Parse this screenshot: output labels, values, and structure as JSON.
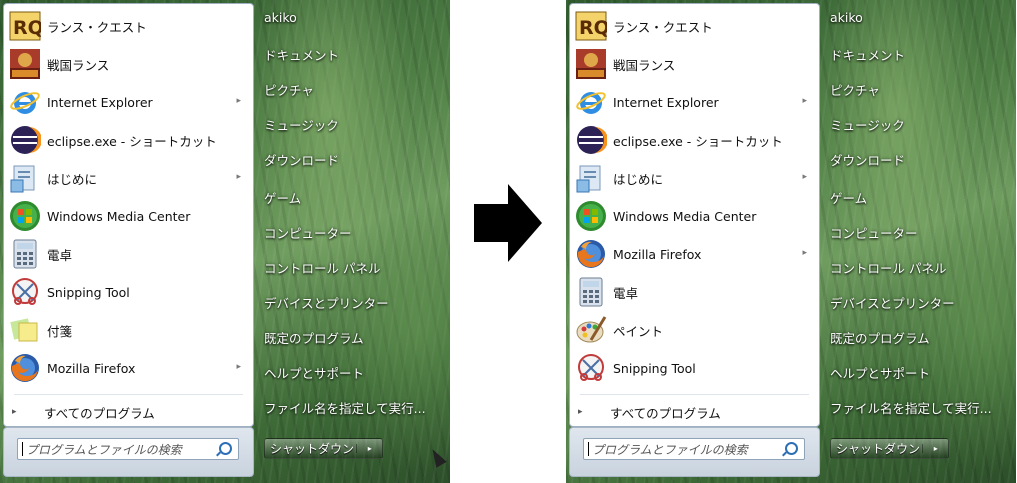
{
  "before": {
    "programs": [
      {
        "label": "ランス・クエスト",
        "icon": "rance-quest-icon",
        "arrow": false
      },
      {
        "label": "戦国ランス",
        "icon": "sengoku-rance-icon",
        "arrow": false
      },
      {
        "label": "Internet Explorer",
        "icon": "internet-explorer-icon",
        "arrow": true
      },
      {
        "label": "eclipse.exe - ショートカット",
        "icon": "eclipse-icon",
        "arrow": false
      },
      {
        "label": "はじめに",
        "icon": "getting-started-icon",
        "arrow": true
      },
      {
        "label": "Windows Media Center",
        "icon": "windows-media-center-icon",
        "arrow": false
      },
      {
        "label": "電卓",
        "icon": "calculator-icon",
        "arrow": false
      },
      {
        "label": "Snipping Tool",
        "icon": "snipping-tool-icon",
        "arrow": false
      },
      {
        "label": "付箋",
        "icon": "sticky-notes-icon",
        "arrow": false
      },
      {
        "label": "Mozilla Firefox",
        "icon": "firefox-icon",
        "arrow": true
      }
    ],
    "all_programs": "すべてのプログラム",
    "search_placeholder": "プログラムとファイルの検索",
    "places": [
      "akiko",
      "ドキュメント",
      "ピクチャ",
      "ミュージック",
      "ダウンロード",
      "ゲーム",
      "コンピューター",
      "コントロール パネル",
      "デバイスとプリンター",
      "既定のプログラム",
      "ヘルプとサポート",
      "ファイル名を指定して実行..."
    ],
    "shutdown": "シャットダウン"
  },
  "after": {
    "programs": [
      {
        "label": "ランス・クエスト",
        "icon": "rance-quest-icon",
        "arrow": false
      },
      {
        "label": "戦国ランス",
        "icon": "sengoku-rance-icon",
        "arrow": false
      },
      {
        "label": "Internet Explorer",
        "icon": "internet-explorer-icon",
        "arrow": true
      },
      {
        "label": "eclipse.exe - ショートカット",
        "icon": "eclipse-icon",
        "arrow": false
      },
      {
        "label": "はじめに",
        "icon": "getting-started-icon",
        "arrow": true
      },
      {
        "label": "Windows Media Center",
        "icon": "windows-media-center-icon",
        "arrow": false
      },
      {
        "label": "Mozilla Firefox",
        "icon": "firefox-icon",
        "arrow": true
      },
      {
        "label": "電卓",
        "icon": "calculator-icon",
        "arrow": false
      },
      {
        "label": "ペイント",
        "icon": "paint-icon",
        "arrow": false
      },
      {
        "label": "Snipping Tool",
        "icon": "snipping-tool-icon",
        "arrow": false
      }
    ],
    "all_programs": "すべてのプログラム",
    "search_placeholder": "プログラムとファイルの検索",
    "places": [
      "akiko",
      "ドキュメント",
      "ピクチャ",
      "ミュージック",
      "ダウンロード",
      "ゲーム",
      "コンピューター",
      "コントロール パネル",
      "デバイスとプリンター",
      "既定のプログラム",
      "ヘルプとサポート",
      "ファイル名を指定して実行..."
    ],
    "shutdown": "シャットダウン"
  },
  "arrow_glyph": "▸"
}
